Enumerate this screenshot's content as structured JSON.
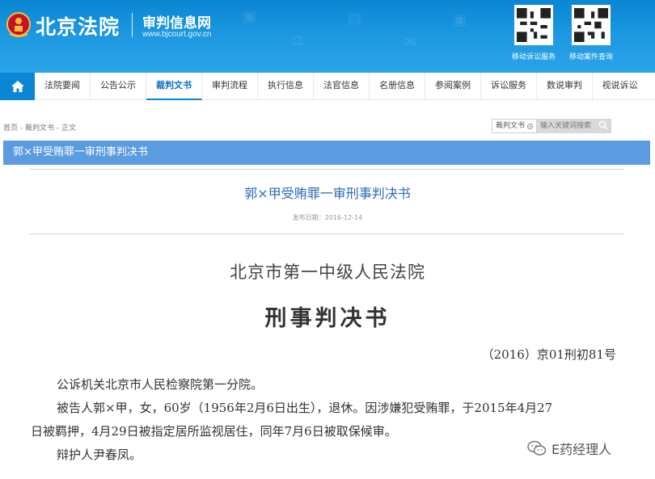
{
  "header": {
    "site_name": "北京法院",
    "sub_title": "审判信息网",
    "url_text": "www.bjcourt.gov.cn",
    "qr_codes": [
      {
        "label": "移动诉讼服务"
      },
      {
        "label": "移动案件查询"
      }
    ],
    "accent_color": "#0a86d4"
  },
  "nav": {
    "home_icon": "home-icon",
    "items": [
      {
        "label": "法院要闻",
        "active": false
      },
      {
        "label": "公告公示",
        "active": false
      },
      {
        "label": "裁判文书",
        "active": true
      },
      {
        "label": "审判流程",
        "active": false
      },
      {
        "label": "执行信息",
        "active": false
      },
      {
        "label": "法官信息",
        "active": false
      },
      {
        "label": "名册信息",
        "active": false
      },
      {
        "label": "参阅案例",
        "active": false
      },
      {
        "label": "诉讼服务",
        "active": false
      },
      {
        "label": "数说审判",
        "active": false
      },
      {
        "label": "视说诉讼",
        "active": false
      }
    ]
  },
  "breadcrumb": "首页 - 裁判文书 - 正文",
  "search": {
    "category": "裁判文书",
    "placeholder": "输入关键词搜索"
  },
  "title_bar": "郭×甲受贿罪一审刑事判决书",
  "document": {
    "title": "郭×甲受贿罪一审刑事判决书",
    "publish_date": "发布日期：2016-12-14",
    "court": "北京市第一中级人民法院",
    "doc_type": "刑事判决书",
    "doc_number": "（2016）京01刑初81号",
    "paragraphs": {
      "p1": "公诉机关北京市人民检察院第一分院。",
      "p2_line1": "被告人郭×甲，女，60岁（1956年2月6日出生），退休。因涉嫌犯受贿罪，于2015年4月27",
      "p2_line2": "日被羁押，4月29日被指定居所监视居住，同年7月6日被取保候审。",
      "p3": "辩护人尹春凤。"
    }
  },
  "watermark": {
    "text": "E药经理人",
    "icon": "wechat-icon"
  }
}
